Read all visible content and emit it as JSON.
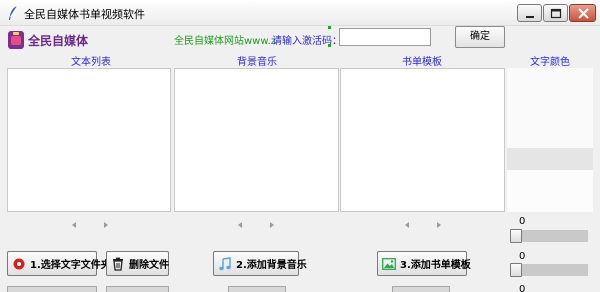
{
  "window": {
    "title": "全民自媒体书单视频软件",
    "controls": [
      "minimize",
      "maximize",
      "close"
    ]
  },
  "header": {
    "logo_text": "全民自媒体",
    "site_text": "全民自媒体网站www.z",
    "prompt_text": "请输入激活码：",
    "code_input_value": "",
    "confirm_label": "确定"
  },
  "columns": {
    "text_list": "文本列表",
    "bg_music": "背景音乐",
    "book_template": "书单模板",
    "text_color": "文字颜色"
  },
  "sliders": [
    {
      "value": "0",
      "level": 0
    },
    {
      "value": "0",
      "level": 0
    },
    {
      "value": "0",
      "level": 0
    }
  ],
  "buttons": {
    "select_folder": "1.选择文字文件夹",
    "delete_file": "删除文件",
    "add_music": "2.添加背景音乐",
    "add_template": "3.添加书单模板"
  },
  "icons": {
    "select_folder": "red-record-icon",
    "delete_file": "trash-icon",
    "add_music": "music-note-icon",
    "add_template": "image-icon"
  },
  "colors": {
    "site_text": "#1ba01b",
    "accent_blue": "#2a2ad6",
    "logo_purple": "#6a2a8a"
  }
}
